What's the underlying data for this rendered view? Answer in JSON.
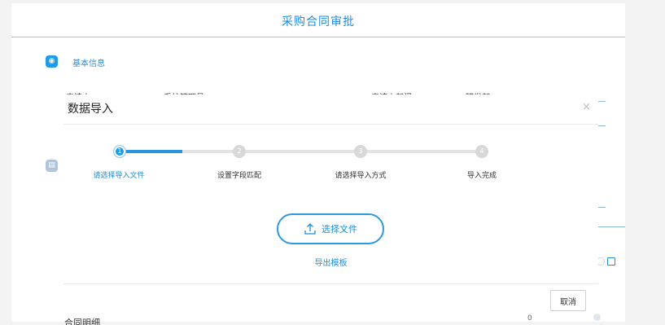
{
  "page": {
    "title": "采购合同审批",
    "section_basic": "基本信息",
    "applicant_label": "申请人",
    "applicant_value": "系统管理员",
    "dept_label": "申请人部门",
    "dept_value": "研发部",
    "detail_section": "合同明细",
    "detail_count": "0"
  },
  "dialog": {
    "title": "数据导入",
    "close_glyph": "×",
    "steps": [
      {
        "num": "1",
        "label": "请选择导入文件",
        "active": true
      },
      {
        "num": "2",
        "label": "设置字段匹配",
        "active": false
      },
      {
        "num": "3",
        "label": "请选择导入方式",
        "active": false
      },
      {
        "num": "4",
        "label": "导入完成",
        "active": false
      }
    ],
    "upload_label": "选择文件",
    "export_template": "导出模板",
    "cancel_label": "取消"
  },
  "colors": {
    "accent": "#1e8ed6",
    "step_inactive": "#d8d8d8",
    "title_underline": "#9fd0a3"
  },
  "icons": {
    "upload": "upload-icon",
    "close": "close-icon",
    "section": "info-icon"
  }
}
